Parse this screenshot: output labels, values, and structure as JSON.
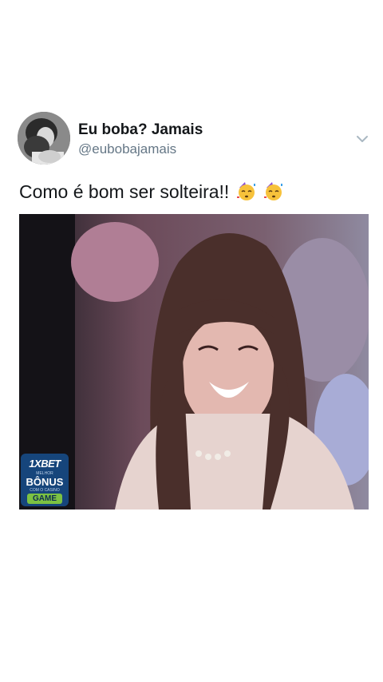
{
  "tweet": {
    "display_name": "Eu boba? Jamais",
    "handle": "@eubobajamais",
    "text": "Como é bom ser solteira!!",
    "emojis": [
      "partying-face-emoji",
      "partying-face-emoji"
    ]
  },
  "media": {
    "ad_badge": {
      "brand": "1XBET",
      "small_top": "MELHOR",
      "bonus": "BÔNUS",
      "small_bottom": "COM O CASINO",
      "game": "GAME"
    }
  },
  "colors": {
    "name": "#14171a",
    "handle": "#657786",
    "ad_background": "#16457b",
    "ad_game": "#7cc242"
  }
}
